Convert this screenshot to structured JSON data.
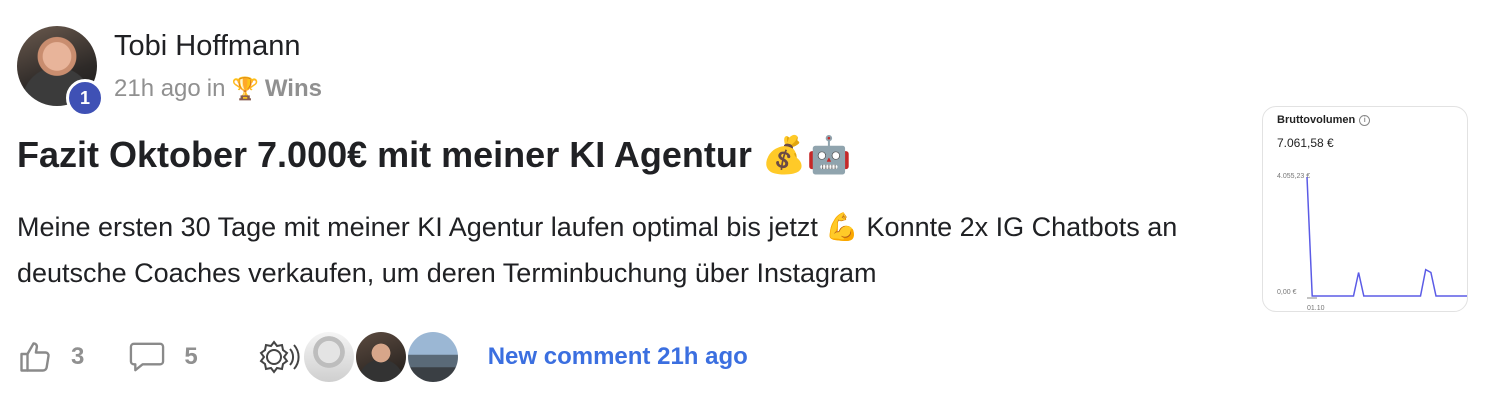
{
  "post": {
    "author": "Tobi Hoffmann",
    "level": "1",
    "time": "21h ago",
    "in_label": "in",
    "category_icon": "trophy-icon",
    "category": "Wins",
    "title": "Fazit Oktober 7.000€ mit meiner KI Agentur 💰🤖",
    "body": "Meine ersten 30 Tage mit meiner KI Agentur laufen optimal bis jetzt 💪 Konnte 2x IG Chatbots an deutsche Coaches verkaufen, um deren Terminbuchung über Instagram"
  },
  "actions": {
    "likes": "3",
    "comments": "5",
    "new_comment": "New comment 21h ago"
  },
  "chart_data": {
    "type": "line",
    "title": "Bruttovolumen",
    "total": "7.061,58 €",
    "y_max_label": "4.055,23 €",
    "y_min_label": "0,00 €",
    "x_label": "01.10",
    "ylim": [
      0,
      4055.23
    ],
    "values": [
      4055.23,
      0,
      0,
      0,
      0,
      0,
      0,
      0,
      0,
      0,
      800,
      0,
      0,
      0,
      0,
      0,
      0,
      0,
      0,
      0,
      0,
      0,
      0,
      900,
      800,
      0,
      0,
      0,
      0,
      0,
      0,
      0
    ],
    "color": "#5b5be6"
  }
}
